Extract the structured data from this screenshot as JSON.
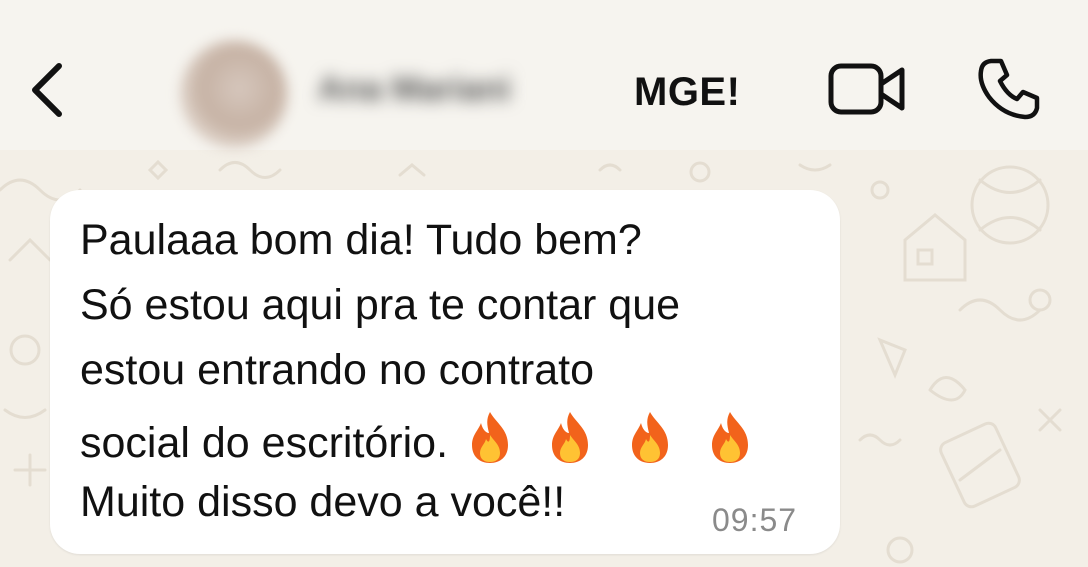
{
  "header": {
    "back_icon": "chevron-left-icon",
    "contact_name": "Ana Mariani",
    "contact_tag": "MGE!",
    "video_icon": "video-camera-icon",
    "call_icon": "phone-icon"
  },
  "message": {
    "lines": [
      "Paulaaa bom dia! Tudo bem?",
      "Só estou aqui pra te contar que",
      "estou entrando no contrato",
      "social do escritório.",
      "Muito disso devo a você!!"
    ],
    "emoji": [
      "🔥",
      "🔥",
      "🔥",
      "🔥"
    ],
    "time": "09:57"
  },
  "colors": {
    "chat_background": "#f3efe7",
    "bubble": "#ffffff",
    "text": "#111111",
    "timestamp": "#8a8a8a"
  }
}
